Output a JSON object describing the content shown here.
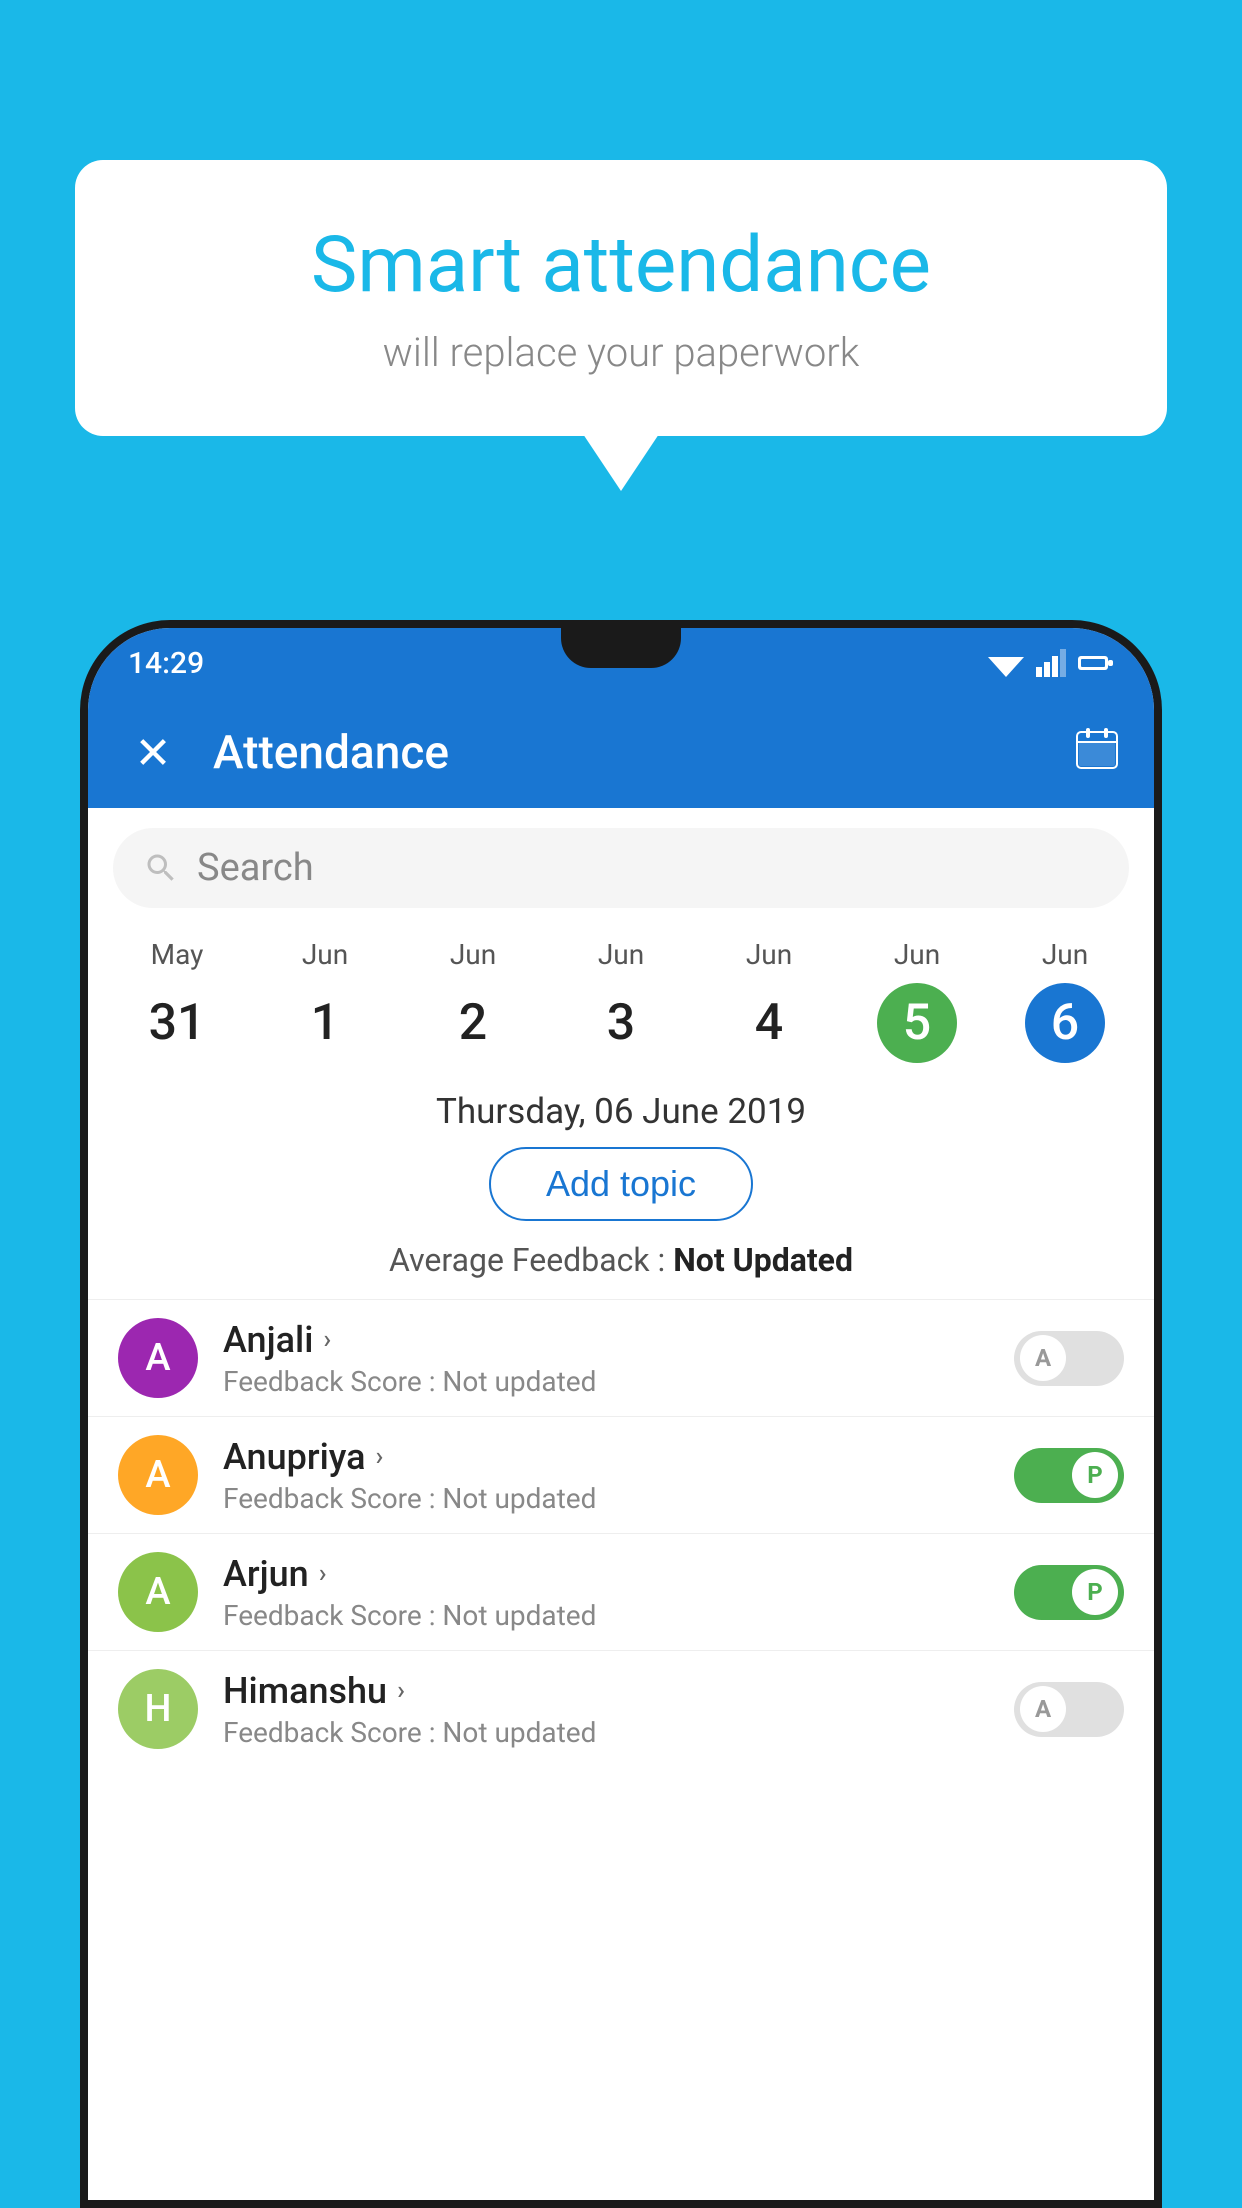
{
  "background_color": "#1ab8e8",
  "bubble": {
    "title": "Smart attendance",
    "subtitle": "will replace your paperwork"
  },
  "status_bar": {
    "time": "14:29"
  },
  "header": {
    "title": "Attendance",
    "close_label": "✕",
    "calendar_icon": "📅"
  },
  "search": {
    "placeholder": "Search"
  },
  "calendar": {
    "days": [
      {
        "month": "May",
        "num": "31",
        "state": "normal"
      },
      {
        "month": "Jun",
        "num": "1",
        "state": "normal"
      },
      {
        "month": "Jun",
        "num": "2",
        "state": "normal"
      },
      {
        "month": "Jun",
        "num": "3",
        "state": "normal"
      },
      {
        "month": "Jun",
        "num": "4",
        "state": "normal"
      },
      {
        "month": "Jun",
        "num": "5",
        "state": "today"
      },
      {
        "month": "Jun",
        "num": "6",
        "state": "selected"
      }
    ]
  },
  "selected_date": "Thursday, 06 June 2019",
  "add_topic_label": "Add topic",
  "avg_feedback_label": "Average Feedback :",
  "avg_feedback_value": "Not Updated",
  "students": [
    {
      "name": "Anjali",
      "avatar_letter": "A",
      "avatar_color": "#9c27b0",
      "feedback": "Feedback Score : Not updated",
      "attendance": "absent",
      "toggle_letter": "A"
    },
    {
      "name": "Anupriya",
      "avatar_letter": "A",
      "avatar_color": "#ffa726",
      "feedback": "Feedback Score : Not updated",
      "attendance": "present",
      "toggle_letter": "P"
    },
    {
      "name": "Arjun",
      "avatar_letter": "A",
      "avatar_color": "#8bc34a",
      "feedback": "Feedback Score : Not updated",
      "attendance": "present",
      "toggle_letter": "P"
    },
    {
      "name": "Himanshu",
      "avatar_letter": "H",
      "avatar_color": "#9ccc65",
      "feedback": "Feedback Score : Not updated",
      "attendance": "absent",
      "toggle_letter": "A"
    }
  ]
}
